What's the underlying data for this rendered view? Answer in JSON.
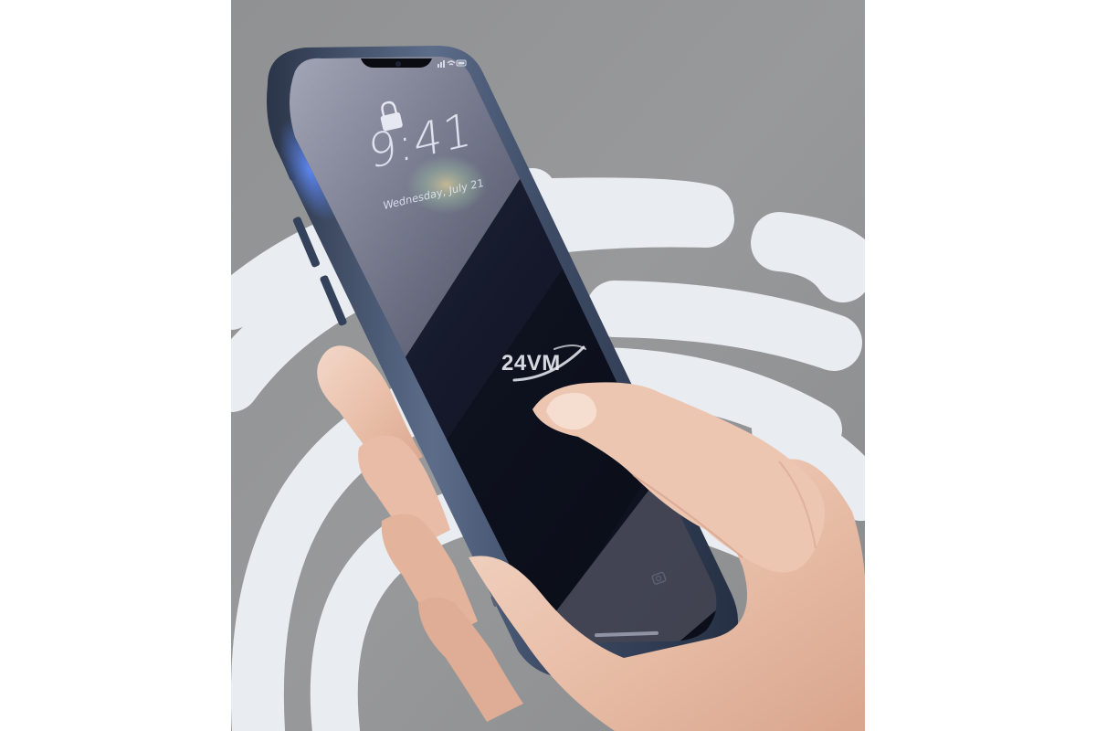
{
  "image": {
    "background_color": "#ffffff",
    "photo_background": "#8e8f91"
  },
  "lockscreen": {
    "time": "9:41",
    "date": "Wednesday, July 21"
  },
  "watermark": {
    "text": "24VM"
  },
  "icons": {
    "lock": "lock-icon",
    "signal": "signal-icon",
    "wifi": "wifi-icon",
    "battery": "battery-icon",
    "camera": "camera-icon",
    "flashlight": "flashlight-icon"
  },
  "colors": {
    "phone_frame": "#3c4a63",
    "screen_dark": "#111422",
    "arc_light": "#e8ebef"
  }
}
